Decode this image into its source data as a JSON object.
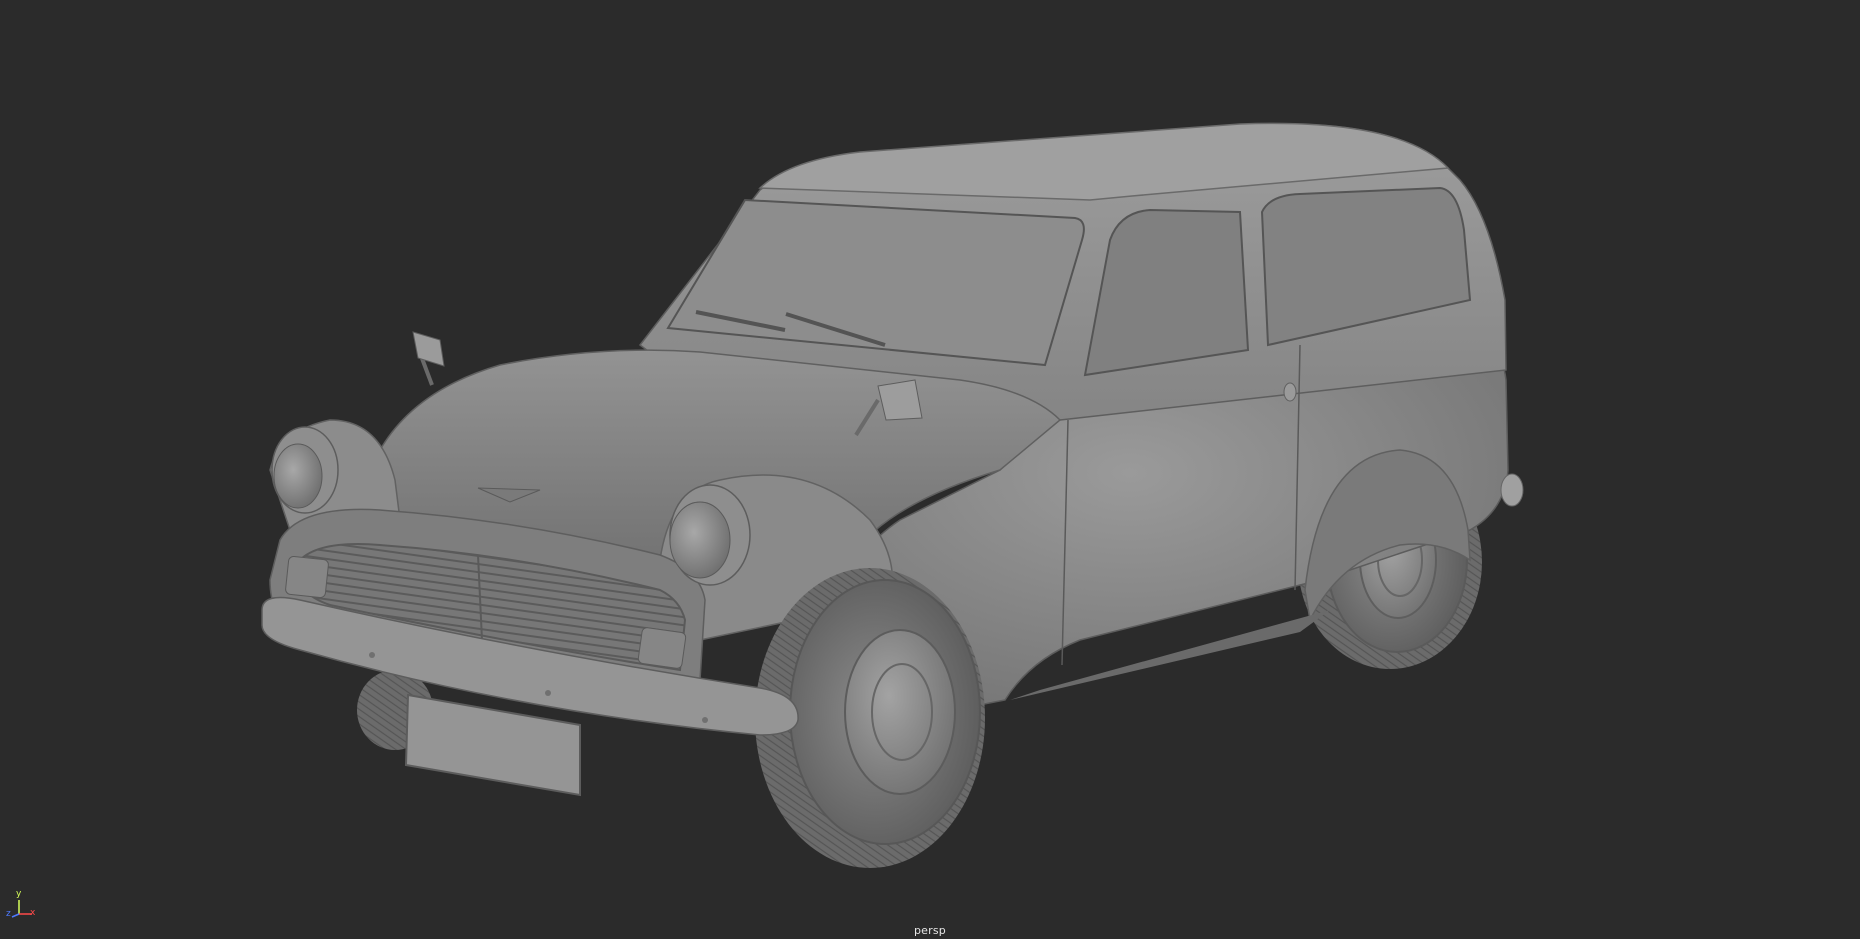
{
  "viewport": {
    "camera_name": "persp",
    "background_color": "#2b2b2b",
    "model_shade_color": "#8a8a8a",
    "object": "car-model"
  },
  "axis_gizmo": {
    "y_label": "y",
    "x_label": "x",
    "z_label": "z",
    "y_color": "#d7ff5a",
    "x_color": "#ff4a4a",
    "z_color": "#4d79ff"
  }
}
